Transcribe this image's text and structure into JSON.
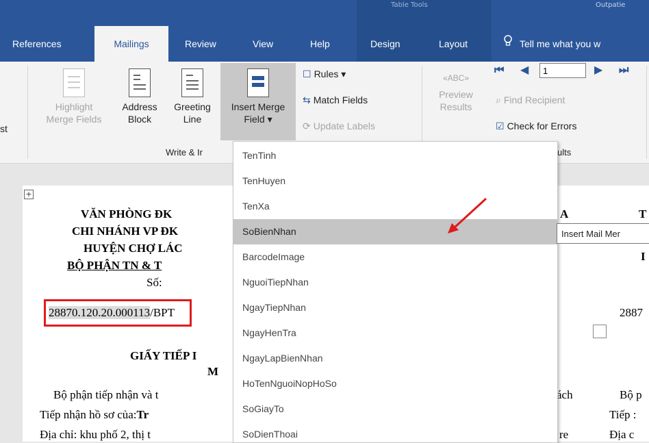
{
  "title_bar": {
    "context_left": "Table Tools",
    "context_right": "Outpatie"
  },
  "tabs": [
    {
      "label": "References",
      "active": false
    },
    {
      "label": "Mailings",
      "active": true
    },
    {
      "label": "Review",
      "active": false
    },
    {
      "label": "View",
      "active": false
    },
    {
      "label": "Help",
      "active": false
    },
    {
      "label": "Design",
      "active": false
    },
    {
      "label": "Layout",
      "active": false
    }
  ],
  "tell_me": "Tell me what you w",
  "ribbon": {
    "cut_label": "st",
    "highlight": {
      "line1": "Highlight",
      "line2": "Merge Fields"
    },
    "address": {
      "line1": "Address",
      "line2": "Block"
    },
    "greeting": {
      "line1": "Greeting",
      "line2": "Line"
    },
    "insert_merge": {
      "line1": "Insert Merge",
      "line2": "Field ▾"
    },
    "rules": "Rules ▾",
    "match_fields": "Match Fields",
    "update_labels": "Update Labels",
    "preview": {
      "line1": "Preview",
      "line2": "Results"
    },
    "record_number": "1",
    "find_recipient": "Find Recipient",
    "check_errors": "Check for Errors",
    "group_write": "Write & Ir",
    "group_results": "ults"
  },
  "dropdown": {
    "items": [
      "TenTinh",
      "TenHuyen",
      "TenXa",
      "SoBienNhan",
      "BarcodeImage",
      "NguoiTiepNhan",
      "NgayTiepNhan",
      "NgayHenTra",
      "NgayLapBienNhan",
      "HoTenNguoiNopHoSo",
      "SoGiayTo",
      "SoDienThoai"
    ],
    "highlighted_index": 3
  },
  "tooltip": "Insert Mail Mer",
  "document": {
    "line1": "VĂN PHÒNG ĐK",
    "line2": "CHI NHÁNH VP ĐK",
    "line3": "HUYỆN CHỢ LÁC",
    "line4": "BỘ PHẬN TN & T",
    "so_label": "Số:",
    "receipt_number": "28870.120.20.000113",
    "receipt_suffix": "/BPT",
    "heading1": "GIẤY TIẾP I",
    "heading2": "M",
    "para1": "Bộ phận tiếp nhận và t",
    "para2_prefix": "Tiếp nhận hồ sơ của:",
    "para2_bold": "Tr",
    "para3": "Địa chỉ: khu phố 2, thị t",
    "right_a": "A",
    "right_t": "T",
    "right_i": "I",
    "right_num": "2887",
    "right_ach": "ách",
    "right_bo": "Bộ p",
    "right_re": "re",
    "right_tiep": "Tiếp :",
    "right_dia": "Địa c"
  },
  "colors": {
    "ribbon_blue": "#2b579a",
    "highlight_red": "#e01b1b",
    "hover_gray": "#c5c5c5"
  }
}
